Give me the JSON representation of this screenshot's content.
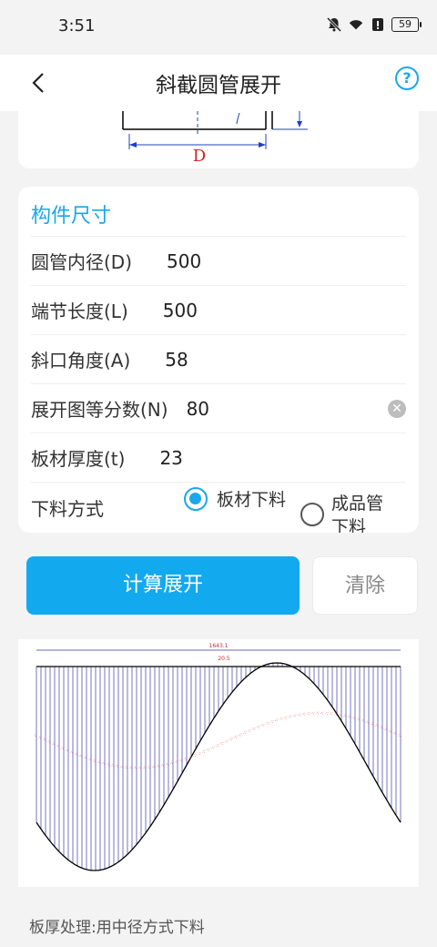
{
  "status": {
    "time": "3:51",
    "battery": "59",
    "icons": [
      "bell-muted-icon",
      "wifi-icon",
      "alert-icon",
      "battery-icon"
    ]
  },
  "app_bar": {
    "title": "斜截圆管展开",
    "back_icon": "back-arrow-icon",
    "help_icon": "help-circle-icon",
    "help_glyph": "?"
  },
  "diagram": {
    "dimension_label": "D"
  },
  "form": {
    "section_title": "构件尺寸",
    "fields": [
      {
        "label": "圆管内径(D)",
        "value": "500"
      },
      {
        "label": "端节长度(L)",
        "value": "500"
      },
      {
        "label": "斜口角度(A)",
        "value": "58"
      },
      {
        "label": "展开图等分数(N)",
        "value": "80"
      },
      {
        "label": "板材厚度(t)",
        "value": "23"
      }
    ],
    "cut_mode": {
      "label": "下料方式",
      "options": [
        {
          "label": "板材下料",
          "selected": true
        },
        {
          "label_line1": "成品管",
          "label_line2": "下料",
          "selected": false
        }
      ]
    }
  },
  "buttons": {
    "calculate": "计算展开",
    "clear": "清除"
  },
  "drawing": {
    "total_length_label": "1643.1",
    "segment_label": "20.5",
    "divisions": 80,
    "line_color": "#3a3aa8",
    "curve_color": "#000000",
    "annotation_color": "#e03030"
  },
  "footer": {
    "note": "板厚处理:用中径方式下料"
  },
  "colors": {
    "accent": "#13a9ef",
    "background": "#f3f3f3",
    "card": "#ffffff"
  }
}
